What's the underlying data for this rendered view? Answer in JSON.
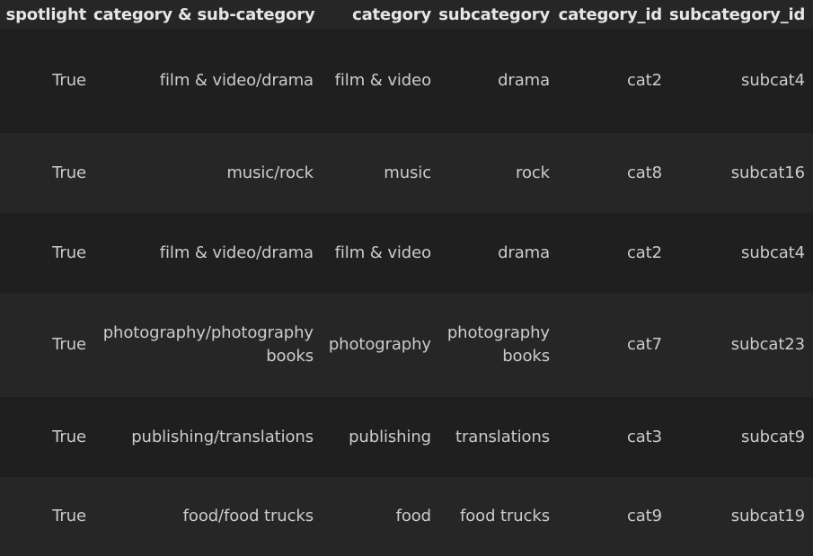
{
  "table": {
    "columns": [
      "spotlight",
      "category & sub-category",
      "category",
      "subcategory",
      "category_id",
      "subcategory_id"
    ],
    "rows": [
      [
        "True",
        "film & video/drama",
        "film & video",
        "drama",
        "cat2",
        "subcat4"
      ],
      [
        "True",
        "music/rock",
        "music",
        "rock",
        "cat8",
        "subcat16"
      ],
      [
        "True",
        "film & video/drama",
        "film & video",
        "drama",
        "cat2",
        "subcat4"
      ],
      [
        "True",
        "photography/photography books",
        "photography",
        "photography books",
        "cat7",
        "subcat23"
      ],
      [
        "True",
        "publishing/translations",
        "publishing",
        "translations",
        "cat3",
        "subcat9"
      ],
      [
        "True",
        "food/food trucks",
        "food",
        "food trucks",
        "cat9",
        "subcat19"
      ]
    ]
  }
}
